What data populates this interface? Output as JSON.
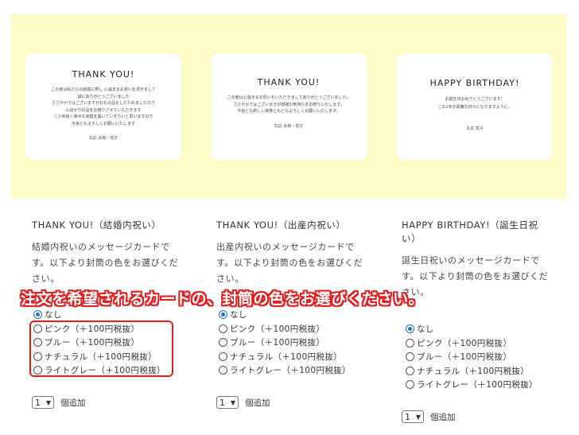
{
  "cards": [
    {
      "title": "THANK YOU!",
      "lines": [
        "この度は私たちの結婚に際し 心温まるお祝いを頂きまして",
        "誠にありがとうございました",
        "ささやかではございますがお礼の品をしたためましたので",
        "心ばかりの品をお贈りさせていただきます",
        "二人仲良く幸せな家庭を築いていきたいと思いますので",
        "今後ともよろしくお願いいたします"
      ],
      "sign": "丸広 太郎・花子"
    },
    {
      "title": "THANK YOU!",
      "lines": [
        "この度は心温まるお祝いをいただきましてありがとうございました。",
        "ささやかではございますが感謝の気持ちをお贈りいたします。",
        "今後とも新しい家族ともどもよろしくお願いいたします。"
      ],
      "sign": "丸広 太郎・花子"
    },
    {
      "title": "HAPPY BIRTHDAY!",
      "lines": [
        "お誕生日おめでとうございます！",
        "この1年が素敵な日々になりますように。"
      ],
      "sign": "丸広 花子"
    }
  ],
  "columns": [
    {
      "title": "THANK YOU!（結婚内祝い）",
      "desc": "結婚内祝いのメッセージカードです。以下より封筒の色をお選びください。",
      "options": [
        "なし",
        "ピンク（＋100円税抜）",
        "ブルー（＋100円税抜）",
        "ナチュラル（＋100円税抜）",
        "ライトグレー（＋100円税抜）"
      ],
      "selected": "なし",
      "qty": "1",
      "qty_label": "個追加"
    },
    {
      "title": "THANK YOU!（出産内祝い）",
      "desc": "出産内祝いのメッセージカードです。以下より封筒の色をお選びください。",
      "options": [
        "なし",
        "ピンク（＋100円税抜）",
        "ブルー（＋100円税抜）",
        "ナチュラル（＋100円税抜）",
        "ライトグレー（＋100円税抜）"
      ],
      "selected": "なし",
      "qty": "1",
      "qty_label": "個追加"
    },
    {
      "title": "HAPPY BIRTHDAY!（誕生日祝い）",
      "desc": "誕生日祝いのメッセージカードです。以下より封筒の色をお選びください。",
      "options": [
        "なし",
        "ピンク（＋100円税抜）",
        "ブルー（＋100円税抜）",
        "ナチュラル（＋100円税抜）",
        "ライトグレー（＋100円税抜）"
      ],
      "selected": "なし",
      "qty": "1",
      "qty_label": "個追加"
    }
  ],
  "callout": "注文を希望されるカードの、封筒の色をお選びください。",
  "colors": {
    "banner": "#fefdc8",
    "accent_red": "#e02020",
    "radio_blue": "#1f6fd1"
  }
}
